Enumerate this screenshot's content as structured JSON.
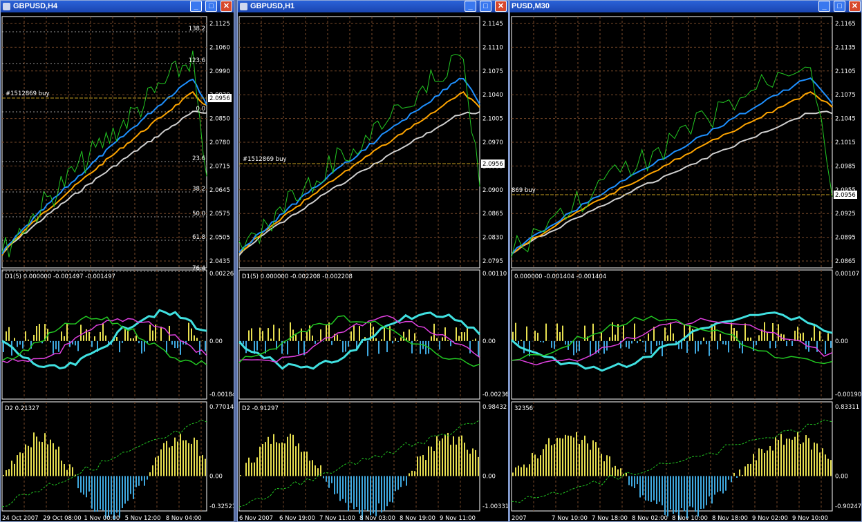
{
  "windows": [
    {
      "id": "h4",
      "title": "GBPUSD,H4",
      "price_scale": [
        "2.1125",
        "2.1060",
        "2.0990",
        "2.0920",
        "2.0850",
        "2.0780",
        "2.0715",
        "2.0645",
        "2.0575",
        "2.0505",
        "2.0435"
      ],
      "fib_levels": [
        "138.2",
        "123.6",
        "0.0",
        "23.6",
        "38.2",
        "50.0",
        "61.8",
        "76.4"
      ],
      "order_label": "#1512869 buy",
      "current_price": "2.0956",
      "d1_label": "D1(5) 0.000000 -0.001497 -0.001497",
      "d1_scale": [
        "0.00226",
        "0.00",
        "-0.00184"
      ],
      "d2_label": "D2 0.21327",
      "d2_scale": [
        "0.77014",
        "0.00",
        "-0.32521"
      ],
      "time_axis": [
        "24 Oct 2007",
        "29 Oct 08:00",
        "1 Nov 00:00",
        "5 Nov 12:00",
        "8 Nov 04:00"
      ]
    },
    {
      "id": "h1",
      "title": "GBPUSD,H1",
      "price_scale": [
        "2.1145",
        "2.1110",
        "2.1075",
        "2.1040",
        "2.1005",
        "2.0970",
        "2.0935",
        "2.0900",
        "2.0865",
        "2.0830",
        "2.0795"
      ],
      "order_label": "#1512869 buy",
      "current_price": "2.0956",
      "d1_label": "D1(5) 0.000000 -0.002208 -0.002208",
      "d1_scale": [
        "0.00110",
        "0.00",
        "-0.00236"
      ],
      "d2_label": "D2 -0.91297",
      "d2_scale": [
        "0.98432",
        "0.00",
        "-1.00331"
      ],
      "time_axis": [
        "6 Nov 2007",
        "6 Nov 19:00",
        "7 Nov 11:00",
        "8 Nov 03:00",
        "8 Nov 19:00",
        "9 Nov 11:00"
      ]
    },
    {
      "id": "m30",
      "title": "PUSD,M30",
      "price_scale": [
        "2.1165",
        "2.1135",
        "2.1105",
        "2.1075",
        "2.1045",
        "2.1015",
        "2.0985",
        "2.0955",
        "2.0925",
        "2.0895",
        "2.0865"
      ],
      "order_label": "869 buy",
      "current_price": "2.0956",
      "d1_label": "0.000000 -0.001404 -0.001404",
      "d1_scale": [
        "0.00107",
        "0.00",
        "-0.00190"
      ],
      "d2_label": "32356",
      "d2_scale": [
        "0.83311",
        "0.00",
        "-0.90247"
      ],
      "time_axis": [
        "2007",
        "7 Nov 10:00",
        "7 Nov 18:00",
        "8 Nov 02:00",
        "8 Nov 10:00",
        "8 Nov 18:00",
        "9 Nov 02:00",
        "9 Nov 10:00"
      ]
    }
  ],
  "controls": {
    "minimize": "_",
    "maximize": "□",
    "close": "✕"
  },
  "colors": {
    "grid": "#7a4a2a",
    "price": "#22c922",
    "ma_fast": "#1e90ff",
    "ma_mid": "#ffa500",
    "ma_slow": "#d0d0d0",
    "hist_pos": "#e8e050",
    "hist_neg": "#3fa9e0",
    "cyan": "#40e0e0",
    "magenta": "#e040e0",
    "arrow": "#4aa0ff"
  }
}
